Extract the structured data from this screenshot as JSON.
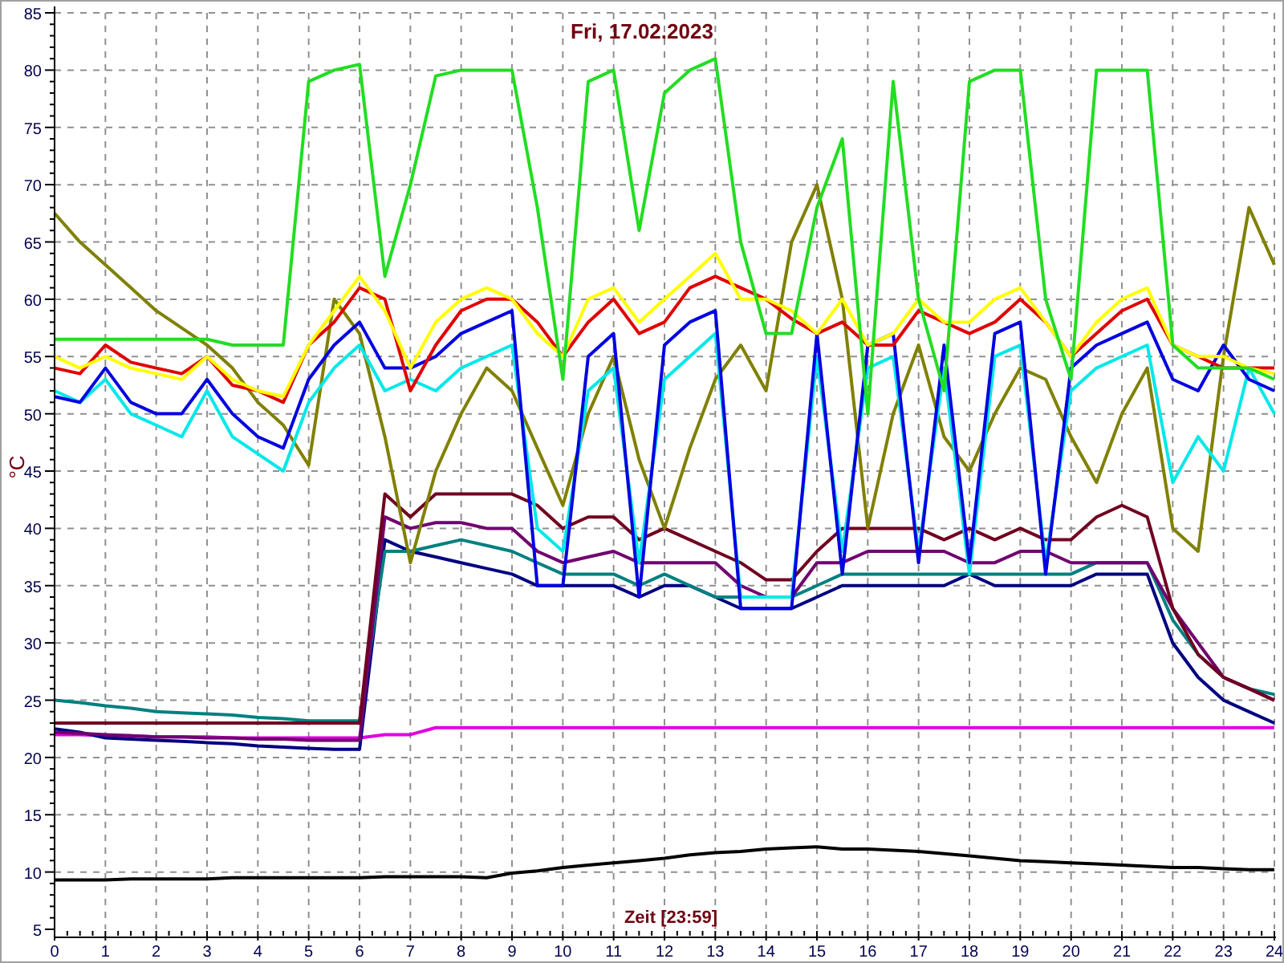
{
  "chart_data": {
    "type": "line",
    "title": "Fri, 17.02.2023",
    "xlabel": "Zeit [23:59]",
    "ylabel": "°C",
    "grid": true,
    "xlim": [
      0,
      24
    ],
    "ylim": [
      5,
      85
    ],
    "xticks": [
      0,
      1,
      2,
      3,
      4,
      5,
      6,
      7,
      8,
      9,
      10,
      11,
      12,
      13,
      14,
      15,
      16,
      17,
      18,
      19,
      20,
      21,
      22,
      23,
      24
    ],
    "yticks": [
      5,
      10,
      15,
      20,
      25,
      30,
      35,
      40,
      45,
      50,
      55,
      60,
      65,
      70,
      75,
      80,
      85
    ],
    "x": [
      0,
      0.5,
      1,
      1.5,
      2,
      2.5,
      3,
      3.5,
      4,
      4.5,
      5,
      5.5,
      6,
      6.5,
      7,
      7.5,
      8,
      8.5,
      9,
      9.5,
      10,
      10.5,
      11,
      11.5,
      12,
      12.5,
      13,
      13.5,
      14,
      14.5,
      15,
      15.5,
      16,
      16.5,
      17,
      17.5,
      18,
      18.5,
      19,
      19.5,
      20,
      20.5,
      21,
      21.5,
      22,
      22.5,
      23,
      23.5,
      24
    ],
    "series": [
      {
        "color": "#000000",
        "values": [
          9.3,
          9.3,
          9.3,
          9.4,
          9.4,
          9.4,
          9.4,
          9.5,
          9.5,
          9.5,
          9.5,
          9.5,
          9.5,
          9.6,
          9.6,
          9.6,
          9.6,
          9.5,
          9.9,
          10.1,
          10.4,
          10.6,
          10.8,
          11,
          11.2,
          11.5,
          11.7,
          11.8,
          12,
          12.1,
          12.2,
          12,
          12,
          11.9,
          11.8,
          11.6,
          11.4,
          11.2,
          11,
          10.9,
          10.8,
          10.7,
          10.6,
          10.5,
          10.4,
          10.4,
          10.3,
          10.2,
          10.2
        ]
      },
      {
        "color": "#e000e0",
        "values": [
          22,
          22,
          21.9,
          21.9,
          21.8,
          21.8,
          21.8,
          21.7,
          21.7,
          21.7,
          21.7,
          21.7,
          21.7,
          22,
          22,
          22.6,
          22.6,
          22.6,
          22.6,
          22.6,
          22.6,
          22.6,
          22.6,
          22.6,
          22.6,
          22.6,
          22.6,
          22.6,
          22.6,
          22.6,
          22.6,
          22.6,
          22.6,
          22.6,
          22.6,
          22.6,
          22.6,
          22.6,
          22.6,
          22.6,
          22.6,
          22.6,
          22.6,
          22.6,
          22.6,
          22.6,
          22.6,
          22.6,
          22.6
        ]
      },
      {
        "color": "#000080",
        "values": [
          22.5,
          22.2,
          21.7,
          21.6,
          21.5,
          21.4,
          21.3,
          21.2,
          21,
          20.9,
          20.8,
          20.7,
          20.7,
          39,
          38,
          37.5,
          37,
          36.5,
          36,
          35,
          35,
          35,
          35,
          34,
          35,
          35,
          34,
          33,
          33,
          33,
          34,
          35,
          35,
          35,
          35,
          35,
          36,
          35,
          35,
          35,
          35,
          36,
          36,
          36,
          30,
          27,
          25,
          24,
          23
        ]
      },
      {
        "color": "#008080",
        "values": [
          25,
          24.8,
          24.5,
          24.3,
          24,
          23.9,
          23.8,
          23.7,
          23.5,
          23.4,
          23.2,
          23.2,
          23.2,
          38,
          38,
          38.5,
          39,
          38.5,
          38,
          37,
          36,
          36,
          36,
          35,
          36,
          35,
          34,
          34,
          34,
          34,
          35,
          36,
          36,
          36,
          36,
          36,
          36,
          36,
          36,
          36,
          36,
          37,
          37,
          37,
          32,
          29,
          27,
          26,
          25.5
        ]
      },
      {
        "color": "#700070",
        "values": [
          22.2,
          22.1,
          22,
          21.9,
          21.8,
          21.8,
          21.7,
          21.7,
          21.6,
          21.6,
          21.5,
          21.5,
          21.5,
          41,
          40,
          40.5,
          40.5,
          40,
          40,
          38,
          37,
          37.5,
          38,
          37,
          37,
          37,
          37,
          35,
          34,
          34,
          37,
          37,
          38,
          38,
          38,
          38,
          37,
          37,
          38,
          38,
          37,
          37,
          37,
          37,
          33,
          30,
          27,
          26,
          25
        ]
      },
      {
        "color": "#700020",
        "values": [
          23,
          23,
          23,
          23,
          23,
          23,
          23,
          23,
          23,
          23,
          23,
          23,
          23,
          43,
          41,
          43,
          43,
          43,
          43,
          42,
          40,
          41,
          41,
          39,
          40,
          39,
          38,
          37,
          35.5,
          35.5,
          38,
          40,
          40,
          40,
          40,
          39,
          40,
          39,
          40,
          39,
          39,
          41,
          42,
          41,
          33,
          29,
          27,
          26,
          25
        ]
      },
      {
        "color": "#808000",
        "values": [
          67.5,
          65,
          63,
          61,
          59,
          57.5,
          56,
          54,
          51,
          49,
          45.5,
          60,
          57,
          48,
          37,
          45,
          50,
          54,
          52,
          47,
          42,
          50,
          55,
          46,
          40,
          47,
          53,
          56,
          52,
          65,
          70,
          60,
          40,
          50,
          56,
          48,
          45,
          50,
          54,
          53,
          48,
          44,
          50,
          54,
          40,
          38,
          55,
          68,
          63
        ]
      },
      {
        "color": "#00e8e8",
        "values": [
          52,
          51,
          53,
          50,
          49,
          48,
          52,
          48,
          46.5,
          45,
          51,
          54,
          56,
          52,
          53,
          52,
          54,
          55,
          56,
          40,
          38,
          52,
          54,
          37,
          53,
          55,
          57,
          34,
          34,
          34,
          55,
          38,
          54,
          55,
          38,
          54,
          36,
          55,
          56,
          37,
          52,
          54,
          55,
          56,
          44,
          48,
          45,
          54,
          50
        ]
      },
      {
        "color": "#0000e0",
        "values": [
          51.5,
          51,
          54,
          51,
          50,
          50,
          53,
          50,
          48,
          47,
          53,
          56,
          58,
          54,
          54,
          55,
          57,
          58,
          59,
          35,
          35,
          55,
          57,
          34,
          56,
          58,
          59,
          33,
          33,
          33,
          57,
          36,
          56,
          57,
          37,
          56,
          37,
          57,
          58,
          36,
          54,
          56,
          57,
          58,
          53,
          52,
          56,
          53,
          52
        ]
      },
      {
        "color": "#e00000",
        "values": [
          54,
          53.5,
          56,
          54.5,
          54,
          53.5,
          55,
          52.5,
          52,
          51,
          56,
          58,
          61,
          60,
          52,
          56,
          59,
          60,
          60,
          58,
          55,
          58,
          60,
          57,
          58,
          61,
          62,
          61,
          60,
          58.3,
          57,
          58,
          56,
          56,
          59,
          58,
          57,
          58,
          60,
          58,
          55,
          57,
          59,
          60,
          56,
          55,
          54,
          54,
          54
        ]
      },
      {
        "color": "#ffff00",
        "values": [
          55,
          54,
          55,
          54,
          53.5,
          53,
          55,
          53,
          52,
          51.5,
          56,
          59,
          62,
          59,
          54,
          58,
          60,
          61,
          60,
          57,
          55,
          60,
          61,
          58,
          60,
          62,
          64,
          60,
          60,
          59,
          57,
          60,
          56,
          57,
          60,
          58,
          58,
          60,
          61,
          58,
          55,
          58,
          60,
          61,
          56,
          55,
          55,
          54,
          53.5
        ]
      },
      {
        "color": "#22dd22",
        "values": [
          56.5,
          56.5,
          56.5,
          56.5,
          56.5,
          56.5,
          56.5,
          56,
          56,
          56,
          79,
          80,
          80.5,
          62,
          70,
          79.5,
          80,
          80,
          80,
          68,
          53,
          79,
          80,
          66,
          78,
          80,
          81,
          65,
          57,
          57,
          68,
          74,
          50,
          79,
          60,
          52,
          79,
          80,
          80,
          60,
          53,
          80,
          80,
          80,
          56,
          54,
          54,
          54,
          53
        ]
      }
    ]
  }
}
